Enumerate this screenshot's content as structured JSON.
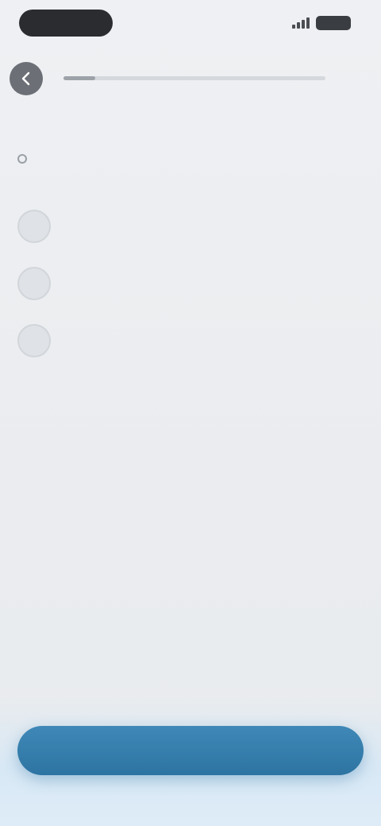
{
  "status_bar": {
    "time": "",
    "battery": ""
  },
  "header": {
    "progress_fraction": 0.12,
    "progress_text": ""
  },
  "main": {
    "title": "",
    "subtitle": "",
    "meta": "",
    "steps": [
      {
        "label": "",
        "title": "",
        "icon": "step-icon"
      },
      {
        "label": "",
        "title": "",
        "icon": "step-icon"
      },
      {
        "label": "",
        "title": "",
        "icon": "step-icon"
      }
    ]
  },
  "cta": {
    "label": ""
  },
  "colors": {
    "accent": "#2f77a6",
    "background": "#eceef1",
    "title": "#2b2e33",
    "muted": "#6b7077"
  }
}
